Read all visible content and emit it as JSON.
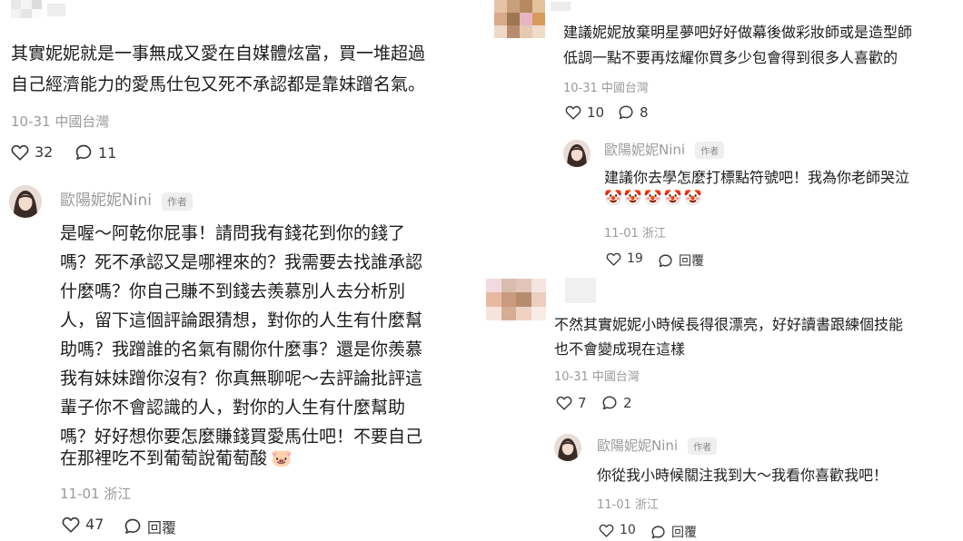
{
  "left": {
    "comment": {
      "lines": [
        "其實妮妮就是一事無成又愛在自媒體炫富，買一堆超過",
        "自己經濟能力的愛馬仕包又死不承認都是靠妹蹭名氣。"
      ],
      "meta": "10-31 中國台灣",
      "likes": "32",
      "replies": "11"
    },
    "reply": {
      "author": "歐陽妮妮Nini",
      "tag": "作者",
      "lines": [
        "是喔～阿乾你屁事！請問我有錢花到你的錢了",
        "嗎？死不承認又是哪裡來的？我需要去找誰承認",
        "什麼嗎？你自己賺不到錢去羨慕別人去分析別",
        "人，留下這個評論跟猜想，對你的人生有什麼幫",
        "助嗎？我蹭誰的名氣有關你什麼事？還是你羨慕",
        "我有妹妹蹭你沒有？你真無聊呢～去評論批評這",
        "輩子你不會認識的人，對你的人生有什麼幫助",
        "嗎？好好想你要怎麼賺錢買愛馬仕吧！不要自己",
        "在那裡吃不到葡萄說葡萄酸"
      ],
      "emoji": "🐷",
      "meta": "11-01 浙江",
      "likes": "47",
      "reply_label": "回覆"
    }
  },
  "right_top": {
    "comment": {
      "lines": [
        "建議妮妮放棄明星夢吧好好做幕後做彩妝師或是造型師",
        "低調一點不要再炫耀你買多少包會得到很多人喜歡的"
      ],
      "meta": "10-31 中國台灣",
      "likes": "10",
      "replies": "8"
    },
    "reply": {
      "author": "歐陽妮妮Nini",
      "tag": "作者",
      "text": "建議你去學怎麼打標點符號吧！我為你老師哭泣",
      "emojis": "🤡🤡🤡🤡🤡",
      "meta": "11-01 浙江",
      "likes": "19",
      "reply_label": "回覆"
    }
  },
  "right_bottom": {
    "comment": {
      "lines": [
        "不然其實妮妮小時候長得很漂亮，好好讀書跟練個技能",
        "也不會變成現在這樣"
      ],
      "meta": "10-31 中國台灣",
      "likes": "7",
      "replies": "2"
    },
    "reply": {
      "author": "歐陽妮妮Nini",
      "tag": "作者",
      "text": "你從我小時候關注我到大～我看你喜歡我吧！",
      "meta": "11-01 浙江",
      "likes": "10",
      "reply_label": "回覆"
    }
  },
  "colors": {
    "text": "#1c1c1c",
    "meta": "#9a9a9a",
    "tag_bg": "#efefef"
  },
  "icons": [
    "heart-icon",
    "comment-bubble-icon",
    "avatar-photo",
    "pixelated-avatar"
  ]
}
